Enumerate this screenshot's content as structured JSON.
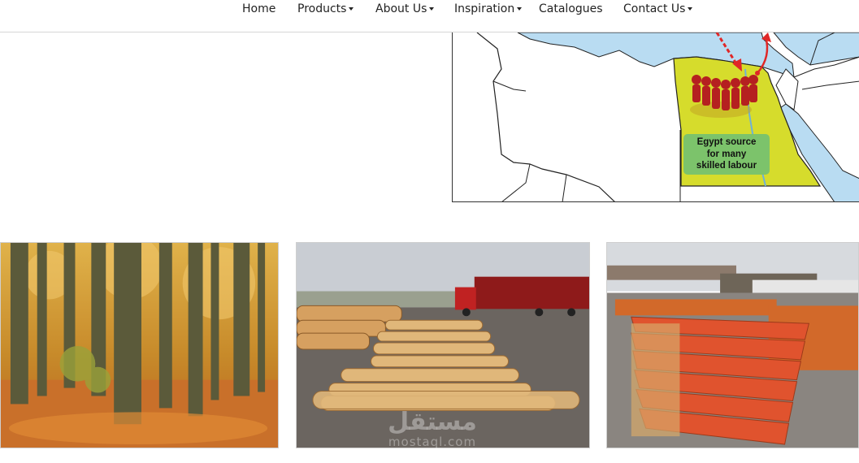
{
  "nav": {
    "items": [
      {
        "label": "Home",
        "has_dropdown": false
      },
      {
        "label": "Products",
        "has_dropdown": true
      },
      {
        "label": "About Us",
        "has_dropdown": true
      },
      {
        "label": "Inspiration",
        "has_dropdown": true
      },
      {
        "label": "Catalogues",
        "has_dropdown": false
      },
      {
        "label": "Contact Us",
        "has_dropdown": true
      }
    ]
  },
  "map": {
    "label_lines": [
      "Egypt source",
      "for many",
      "skilled labour"
    ],
    "colors": {
      "sea": "#b9dcf2",
      "egypt": "#d6dc2c",
      "label": "#7cc36b",
      "arrow": "#e02727",
      "people": "#b52020"
    }
  },
  "photos": [
    {
      "subject": "autumn-forest"
    },
    {
      "subject": "log-yard-with-truck"
    },
    {
      "subject": "stacked-lumber-pallets"
    }
  ],
  "watermark": {
    "arabic": "مستقل",
    "latin": "mostaql.com"
  }
}
